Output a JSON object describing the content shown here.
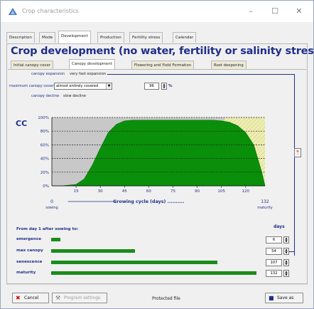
{
  "window": {
    "title": "Crop characteristics",
    "minimize": "–",
    "maximize": "☐",
    "close": "✕"
  },
  "tabs": [
    "Description",
    "Mode",
    "Development",
    "Production",
    "Fertility stress",
    "Calendar"
  ],
  "heading": "Crop development (no water, fertility or salinity stress)",
  "subtabs": [
    "Initial canopy cover",
    "Canopy development",
    "Flowering and Yield Formation",
    "Root deepening"
  ],
  "canopy": {
    "expansion_label": "canopy expansion",
    "expansion_value": "very fast expansion",
    "max_cover_label": "maximum canopy cover",
    "max_cover_option": "almost entirely covered",
    "max_cover_value": "96",
    "max_cover_unit": "%",
    "decline_label": "canopy decline",
    "decline_value": "slow decline"
  },
  "chart_data": {
    "type": "area",
    "ylabel": "CC",
    "xlabel": "Growing cycle (days) ..........",
    "y_ticks": [
      "100%",
      "80%",
      "60%",
      "40%",
      "20%",
      "0%"
    ],
    "x_ticks": [
      "15",
      "30",
      "45",
      "60",
      "75",
      "90",
      "105",
      "120"
    ],
    "xlim": [
      0,
      132
    ],
    "ylim": [
      0,
      100
    ],
    "x_start_label": "0",
    "x_start_sub": "sowing",
    "x_end_label": "132",
    "x_end_sub": "maturity",
    "x": [
      0,
      6,
      15,
      20,
      25,
      30,
      35,
      40,
      45,
      50,
      54,
      100,
      105,
      110,
      115,
      120,
      125,
      130,
      132
    ],
    "cc": [
      0,
      0,
      2,
      10,
      30,
      55,
      78,
      90,
      95,
      96,
      96,
      96,
      95,
      93,
      88,
      78,
      60,
      20,
      0
    ],
    "colors": {
      "canopy": "#0a8f0a",
      "background": "#c8c8c8",
      "senescence": "#eeeeb0"
    }
  },
  "stages": {
    "header": "From day 1 after sowing to:",
    "days_header": "days",
    "items": [
      {
        "label": "emergence",
        "days": "6"
      },
      {
        "label": "max canopy",
        "days": "54"
      },
      {
        "label": "senescence",
        "days": "107"
      },
      {
        "label": "maturity",
        "days": "132"
      }
    ],
    "max": 132,
    "bar_color": "#1b8c1b"
  },
  "footer": {
    "cancel": "Cancel",
    "program_settings": "Program settings",
    "protected": "Protected file",
    "save_as": "Save as"
  }
}
